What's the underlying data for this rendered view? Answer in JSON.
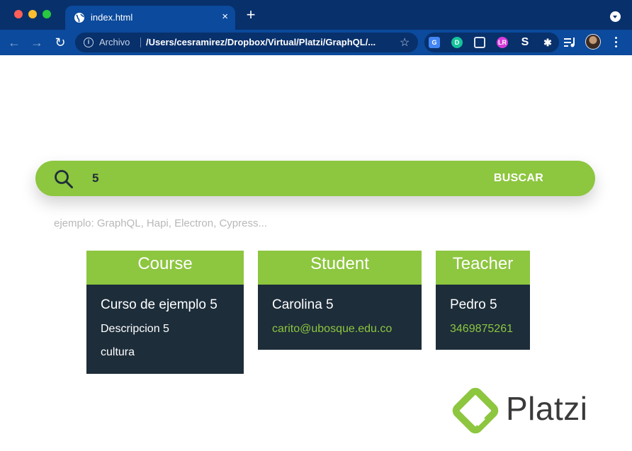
{
  "browser": {
    "tab_title": "index.html",
    "tab_close": "×",
    "new_tab": "+",
    "origin_label": "Archivo",
    "url": "/Users/cesramirez/Dropbox/Virtual/Platzi/GraphQL/...",
    "star": "☆",
    "back": "←",
    "forward": "→",
    "reload": "↻",
    "extensions": {
      "translate": "G",
      "grammarly": "D",
      "lr": "LR",
      "s": "S",
      "puzzle": "✱"
    }
  },
  "search": {
    "value": "5",
    "button_label": "BUSCAR",
    "hint": "ejemplo: GraphQL, Hapi, Electron, Cypress..."
  },
  "cards": {
    "course": {
      "header": "Course",
      "title": "Curso de ejemplo 5",
      "description": "Descripcion 5",
      "topic": "cultura"
    },
    "student": {
      "header": "Student",
      "name": "Carolina 5",
      "email": "carito@ubosque.edu.co"
    },
    "teacher": {
      "header": "Teacher",
      "name": "Pedro 5",
      "phone": "3469875261"
    }
  },
  "logo": {
    "text": "Platzi"
  },
  "colors": {
    "accent": "#8dc63f",
    "card_body": "#1d2d3a",
    "chrome_dark": "#08306b",
    "chrome_light": "#0b4a9c"
  }
}
